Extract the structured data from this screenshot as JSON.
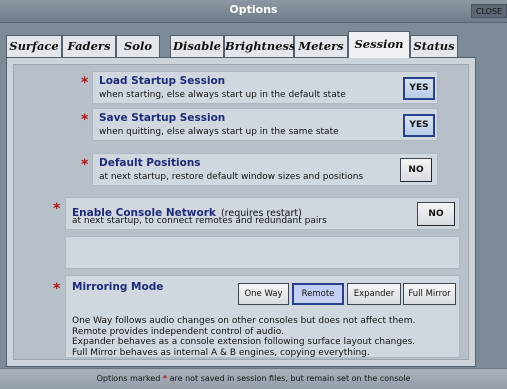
{
  "window": {
    "title": "Options",
    "close_label": "CLOSE"
  },
  "tabs": [
    {
      "label": "Surface"
    },
    {
      "label": "Faders"
    },
    {
      "label": "Solo"
    },
    {
      "label": "Disable"
    },
    {
      "label": "Brightness"
    },
    {
      "label": "Meters"
    },
    {
      "label": "Session",
      "active": true
    },
    {
      "label": "Status"
    }
  ],
  "star": "*",
  "options": {
    "load": {
      "title": "Load Startup Session",
      "sub": "when starting, else always start up in the default state",
      "value": "YES"
    },
    "save": {
      "title": "Save Startup Session",
      "sub": "when quitting, else always start up in the same state",
      "value": "YES"
    },
    "positions": {
      "title": "Default Positions",
      "sub": "at next startup, restore default window sizes and positions",
      "value": "NO"
    },
    "network": {
      "title": "Enable Console Network",
      "title_note": "(requires restart)",
      "sub": "at next startup, to connect remotes and redundant pairs",
      "value": "NO"
    }
  },
  "mirroring": {
    "title": "Mirroring Mode",
    "modes": [
      "One Way",
      "Remote",
      "Expander",
      "Full Mirror"
    ],
    "selected": "Remote",
    "description": [
      "One Way follows audio changes on other consoles but does not affect them.",
      "Remote provides independent control of audio.",
      "Expander behaves as a console extension following surface layout changes.",
      "Full Mirror behaves as internal A & B engines, copying everything."
    ]
  },
  "footer": {
    "before": "Options marked",
    "after": "are not saved in session files, but remain set on the console"
  }
}
